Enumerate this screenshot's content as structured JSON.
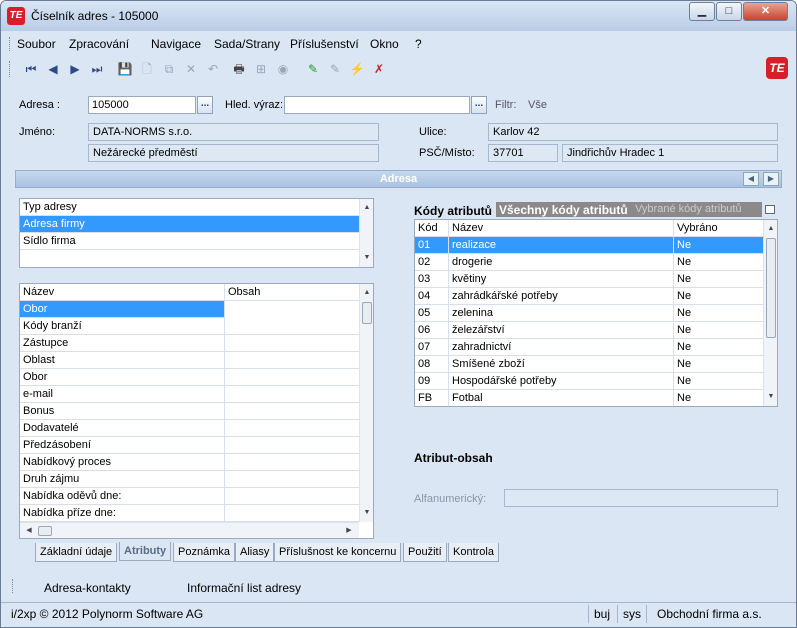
{
  "window": {
    "title": "Číselník adres - 105000",
    "min": "▁",
    "max": "□",
    "close": "✕",
    "icon": "TE"
  },
  "menu": [
    "Soubor",
    "Zpracování",
    "Navigace",
    "Sada/Strany",
    "Příslušenství",
    "Okno",
    "?"
  ],
  "toolbar": {
    "icons": [
      "first-record-icon",
      "prev-record-icon",
      "next-record-icon",
      "last-record-icon",
      "save-icon",
      "new-icon",
      "copy-icon",
      "delete-icon",
      "undo-icon",
      "print-icon",
      "tree-icon",
      "disc-icon",
      "edit-pen-icon",
      "edit-pen-gray-icon",
      "lightning-icon",
      "cancel-icon"
    ],
    "glyphs": [
      "⏮",
      "◀",
      "▶",
      "⏭",
      "💾",
      "🗋",
      "⧉",
      "✕",
      "↶",
      "🖶",
      "⊞",
      "◉",
      "✎",
      "✎",
      "⚡",
      "✗"
    ],
    "logo": "TE"
  },
  "form": {
    "adresa_label": "Adresa :",
    "adresa_value": "105000",
    "dots": "...",
    "hled_label": "Hled. výraz:",
    "hled_value": "",
    "filtr_label": "Filtr:",
    "filtr_value": "Vše",
    "jmeno_label": "Jméno:",
    "jmeno_value": "DATA-NORMS s.r.o.",
    "jmeno2_value": "Nežárecké předměstí",
    "ulice_label": "Ulice:",
    "ulice_value": "Karlov 42",
    "psc_label": "PSČ/Místo:",
    "psc_value": "37701",
    "misto_value": "Jindřichův Hradec 1"
  },
  "section": {
    "title": "Adresa",
    "prev": "◀",
    "next": "▶"
  },
  "typ_adresy": {
    "header": "Typ adresy",
    "rows": [
      "Adresa firmy",
      "Sídlo firma"
    ]
  },
  "obsah_grid": {
    "headers": [
      "Název",
      "Obsah"
    ],
    "rows": [
      "Obor",
      "Kódy branží",
      "Zástupce",
      "Oblast",
      "Obor",
      "e-mail",
      "Bonus",
      "Dodavatelé",
      "Předzásobení",
      "Nabídkový proces",
      "Druh zájmu",
      "Nabídka oděvů dne:",
      "Nabídka příze dne:"
    ]
  },
  "kody": {
    "title": "Kódy atributů",
    "tab_all": "Všechny kódy atributů",
    "tab_sel": "Vybrané kódy atributů",
    "headers": [
      "Kód",
      "Název",
      "Vybráno"
    ],
    "rows": [
      [
        "01",
        "realizace",
        "Ne"
      ],
      [
        "02",
        "drogerie",
        "Ne"
      ],
      [
        "03",
        "květiny",
        "Ne"
      ],
      [
        "04",
        "zahrádkářské potřeby",
        "Ne"
      ],
      [
        "05",
        "zelenina",
        "Ne"
      ],
      [
        "06",
        "železářství",
        "Ne"
      ],
      [
        "07",
        "zahradnictví",
        "Ne"
      ],
      [
        "08",
        "Smíšené zboží",
        "Ne"
      ],
      [
        "09",
        "Hospodářské potřeby",
        "Ne"
      ],
      [
        "FB",
        "Fotbal",
        "Ne"
      ]
    ]
  },
  "atribut": {
    "title": "Atribut-obsah",
    "alfa_label": "Alfanumerický:",
    "alfa_value": ""
  },
  "tabs": [
    "Základní údaje",
    "Atributy",
    "Poznámka",
    "Aliasy",
    "Příslušnost ke koncernu",
    "Použití",
    "Kontrola"
  ],
  "bottom": [
    "Adresa-kontakty",
    "Informační list adresy"
  ],
  "status": {
    "copyright": "i/2xp © 2012 Polynorm Software AG",
    "user": "buj",
    "db": "sys",
    "company": "Obchodní firma a.s."
  }
}
